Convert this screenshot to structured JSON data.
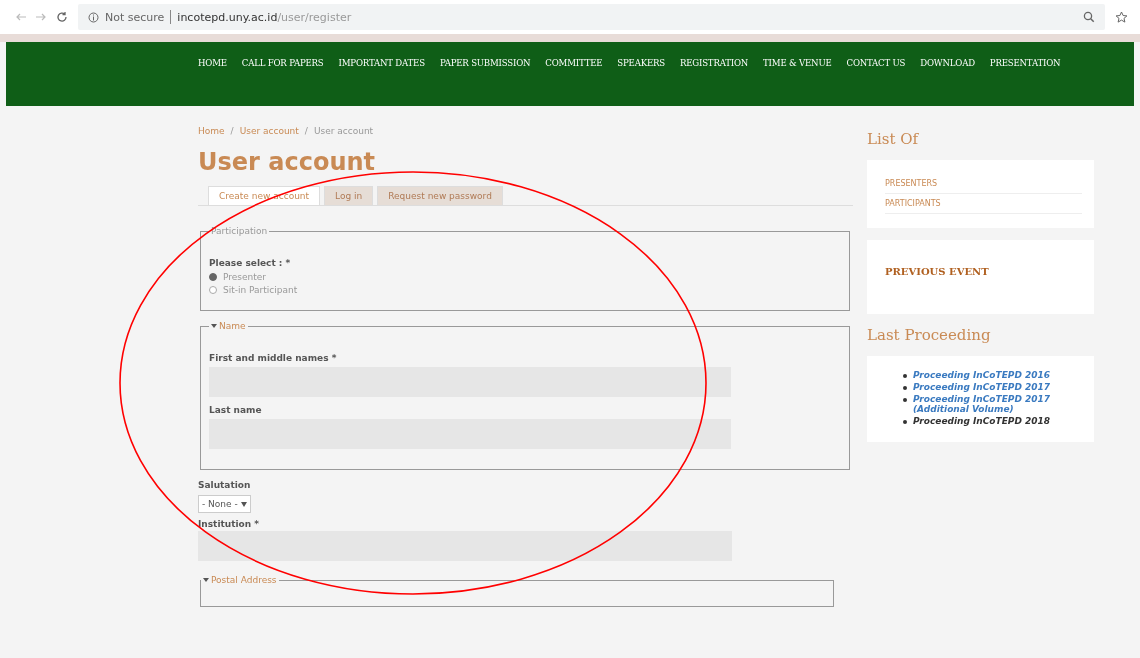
{
  "browser": {
    "security": "Not secure",
    "url_host": "incotepd.uny.ac.id",
    "url_path": "/user/register"
  },
  "nav": [
    {
      "label": "HOME"
    },
    {
      "label": "CALL FOR PAPERS"
    },
    {
      "label": "IMPORTANT DATES"
    },
    {
      "label": "PAPER SUBMISSION"
    },
    {
      "label": "COMMITTEE"
    },
    {
      "label": "SPEAKERS"
    },
    {
      "label": "REGISTRATION"
    },
    {
      "label": "TIME & VENUE"
    },
    {
      "label": "CONTACT US"
    },
    {
      "label": "DOWNLOAD"
    },
    {
      "label": "PRESENTATION"
    }
  ],
  "breadcrumb": [
    "Home",
    "User account",
    "User account"
  ],
  "breadcrumb_separator": "/",
  "title": "User account",
  "tabs": [
    {
      "label": "Create new account",
      "selected": true
    },
    {
      "label": "Log in",
      "selected": false
    },
    {
      "label": "Request new password",
      "selected": false
    }
  ],
  "participation": {
    "legend": "Participation",
    "label": "Please select : *",
    "options": [
      {
        "label": "Presenter",
        "selected": true
      },
      {
        "label": "Sit-in Participant",
        "selected": false
      }
    ]
  },
  "name_group": {
    "legend": "Name",
    "expanded": true,
    "fields": [
      {
        "label": "First and middle names *"
      },
      {
        "label": "Last name"
      }
    ]
  },
  "salutation": {
    "label": "Salutation",
    "value": "- None -"
  },
  "institution": {
    "label": "Institution *"
  },
  "postal": {
    "legend": "Postal Address",
    "expanded": true
  },
  "sidebar": {
    "list_title": "List Of",
    "list_items": [
      "PRESENTERS",
      "PARTICIPANTS"
    ],
    "previous_event": "PREVIOUS EVENT",
    "proceeding_title": "Last Proceeding",
    "proceedings": [
      {
        "label": "Proceeding InCoTEPD 2016",
        "visited": false
      },
      {
        "label": "Proceeding InCoTEPD 2017",
        "visited": false
      },
      {
        "label": "Proceeding InCoTEPD 2017 (Additional Volume)",
        "visited": false
      },
      {
        "label": "Proceeding InCoTEPD 2018",
        "visited": true
      }
    ]
  }
}
